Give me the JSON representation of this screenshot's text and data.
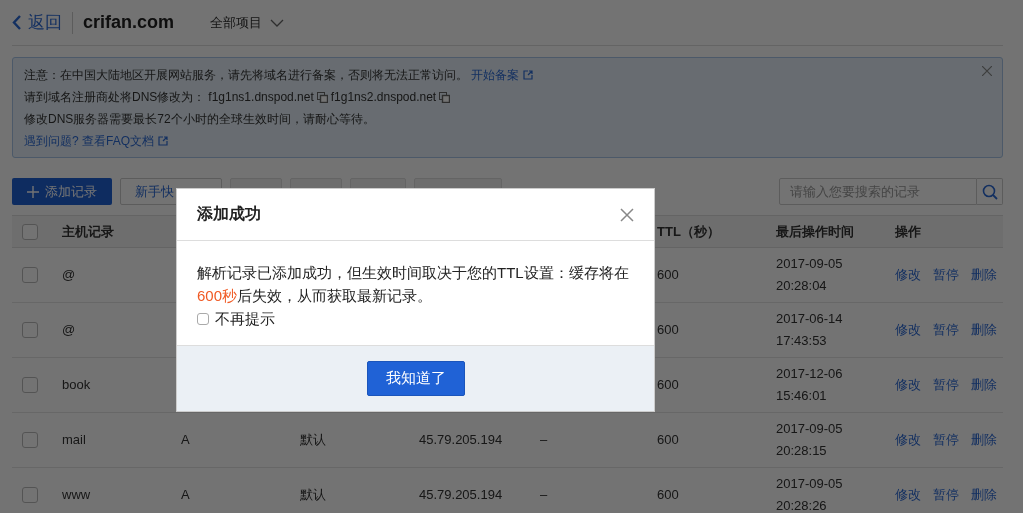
{
  "header": {
    "back": "返回",
    "domain": "crifan.com",
    "project_filter": "全部项目"
  },
  "notice": {
    "lines": [
      {
        "kind": "link",
        "text": "注意：在中国大陆地区开展网站服务，请先将域名进行备案，否则将无法正常访问。",
        "link": "开始备案"
      },
      {
        "kind": "servers",
        "text": "请到域名注册商处将DNS修改为：",
        "servers": [
          "f1g1ns1.dnspod.net",
          "f1g1ns2.dnspod.net"
        ]
      },
      {
        "kind": "plain",
        "text": "修改DNS服务器需要最长72个小时的全球生效时间，请耐心等待。"
      },
      {
        "kind": "help",
        "link": "遇到问题? 查看FAQ文档"
      }
    ]
  },
  "toolbar": {
    "buttons": [
      {
        "label": "添加记录",
        "kind": "primary"
      },
      {
        "label": "新手快",
        "kind": "default"
      },
      {
        "kind": "disabled"
      },
      {
        "kind": "disabled"
      },
      {
        "kind": "disabled"
      },
      {
        "kind": "disabled"
      }
    ],
    "search": {
      "placeholder": "请输入您要搜索的记录"
    }
  },
  "table": {
    "select_all_checked": false,
    "columns": {
      "host": "主机记录",
      "ttl": "TTL（秒）",
      "time": "最后操作时间",
      "actions": "操作"
    },
    "rows": [
      {
        "checked": false,
        "host": "@",
        "ttl": "600",
        "time": [
          "2017-09-05",
          "20:28:04"
        ],
        "actions": [
          "修改",
          "暂停",
          "删除"
        ]
      },
      {
        "checked": false,
        "host": "@",
        "ttl": "600",
        "time": [
          "2017-06-14",
          "17:43:53"
        ],
        "actions": [
          "修改",
          "暂停",
          "删除"
        ]
      },
      {
        "checked": false,
        "host": "book",
        "ttl": "600",
        "time": [
          "2017-12-06",
          "15:46:01"
        ],
        "actions": [
          "修改",
          "暂停",
          "删除"
        ]
      },
      {
        "checked": false,
        "host": "mail",
        "type": "A",
        "line": "默认",
        "value": "45.79.205.194",
        "status": "–",
        "ttl": "600",
        "time": [
          "2017-09-05",
          "20:28:15"
        ],
        "actions": [
          "修改",
          "暂停",
          "删除"
        ]
      },
      {
        "checked": false,
        "host": "www",
        "type": "A",
        "line": "默认",
        "value": "45.79.205.194",
        "status": "–",
        "ttl": "600",
        "time": [
          "2017-09-05",
          "20:28:26"
        ],
        "actions": [
          "修改",
          "暂停",
          "删除"
        ]
      }
    ]
  },
  "dialog": {
    "title": "添加成功",
    "message": [
      {
        "text": "解析记录已添加成功，但生效时间取决于您的TTL设置：缓存将在",
        "highlight": false
      },
      {
        "text": "600秒",
        "highlight": true
      },
      {
        "text": "后失效，从而获取最新记录。",
        "highlight": false
      }
    ],
    "dont_show_again": {
      "label": "不再提示",
      "checked": false
    },
    "confirm": "我知道了"
  }
}
